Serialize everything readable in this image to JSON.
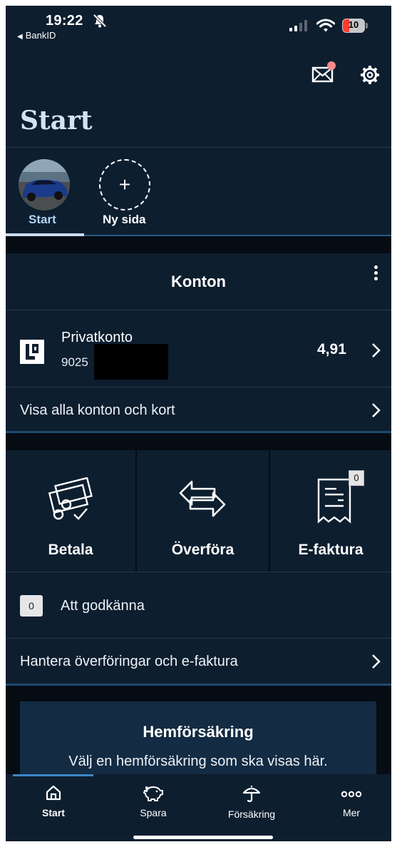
{
  "status_bar": {
    "time": "19:22",
    "back_app": "BankID",
    "battery_level": "10",
    "icons": [
      "bell-muted-icon",
      "cellular-signal-icon",
      "wifi-icon",
      "battery-icon"
    ]
  },
  "header": {
    "title": "Start",
    "icons": [
      "mail-icon",
      "gear-icon"
    ],
    "mail_has_notification": true,
    "notification_color": "#f58b8b"
  },
  "page_tabs": [
    {
      "label": "Start",
      "selected": true
    },
    {
      "label": "Ny sida",
      "selected": false
    }
  ],
  "accounts": {
    "title": "Konton",
    "account": {
      "name": "Privatkonto",
      "number": "9025",
      "balance": "4,91"
    },
    "show_all": "Visa alla konton och kort"
  },
  "actions": [
    {
      "label": "Betala",
      "icon": "payment-icon"
    },
    {
      "label": "Överföra",
      "icon": "transfer-arrows-icon"
    },
    {
      "label": "E-faktura",
      "icon": "receipt-icon",
      "badge": "0"
    }
  ],
  "approve": {
    "count": "0",
    "label": "Att godkänna"
  },
  "manage_link": "Hantera överföringar och e-faktura",
  "promo": {
    "title": "Hemförsäkring",
    "text": "Välj en hemförsäkring som ska visas här."
  },
  "bottom_nav": [
    {
      "label": "Start",
      "icon": "home-icon",
      "active": true
    },
    {
      "label": "Spara",
      "icon": "piggy-bank-icon",
      "active": false
    },
    {
      "label": "Försäkring",
      "icon": "umbrella-icon",
      "active": false
    },
    {
      "label": "Mer",
      "icon": "more-dots-icon",
      "active": false
    }
  ],
  "colors": {
    "background": "#0d1e2f",
    "separator_band": "#050c14",
    "accent_blue": "#3d85c6",
    "selected_tab_text": "#b3d4f5",
    "title_text": "#d4e3f3"
  }
}
